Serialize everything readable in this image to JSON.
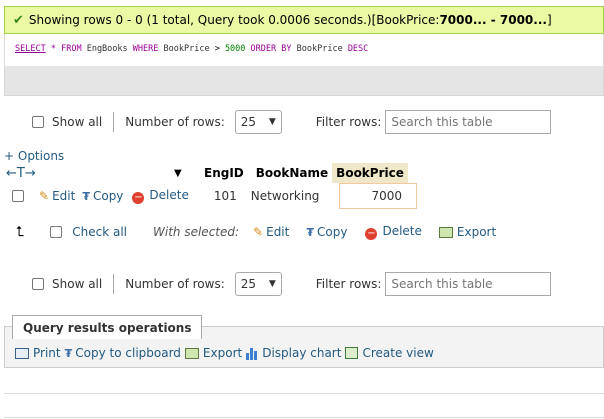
{
  "success": {
    "message": "Showing rows 0 - 0 (1 total, Query took 0.0006 seconds.) ",
    "filter_prefix": "[BookPrice: ",
    "filter_value": "7000... - 7000...",
    "filter_suffix": "]"
  },
  "sql": {
    "select": "SELECT",
    "star": "*",
    "from": "FROM",
    "table": "EngBooks",
    "where": "WHERE",
    "column": "BookPrice",
    "operator": ">",
    "value": "5000",
    "order_by": "ORDER BY",
    "order_column": "BookPrice",
    "direction": "DESC"
  },
  "nav_top": {
    "show_all": "Show all",
    "rows_label": "Number of rows:",
    "rows_value": "25",
    "filter_label": "Filter rows:",
    "filter_placeholder": "Search this table"
  },
  "options_link": "+ Options",
  "table": {
    "arrows": "←T→",
    "columns": [
      "EngID",
      "BookName",
      "BookPrice"
    ],
    "row": {
      "edit": "Edit",
      "copy": "Copy",
      "delete": "Delete",
      "engid": "101",
      "bookname": "Networking",
      "bookprice": "7000"
    }
  },
  "bulk": {
    "check_all": "Check all",
    "with_selected": "With selected:",
    "edit": "Edit",
    "copy": "Copy",
    "delete": "Delete",
    "export": "Export"
  },
  "nav_bottom": {
    "show_all": "Show all",
    "rows_label": "Number of rows:",
    "rows_value": "25",
    "filter_label": "Filter rows:",
    "filter_placeholder": "Search this table"
  },
  "query_ops": {
    "title": "Query results operations",
    "print": "Print",
    "copy_clipboard": "Copy to clipboard",
    "export": "Export",
    "display_chart": "Display chart",
    "create_view": "Create view"
  },
  "colors": {
    "success_bg": "#ebf8a4",
    "link": "#235a81",
    "highlight_header": "#f0e7c8"
  }
}
